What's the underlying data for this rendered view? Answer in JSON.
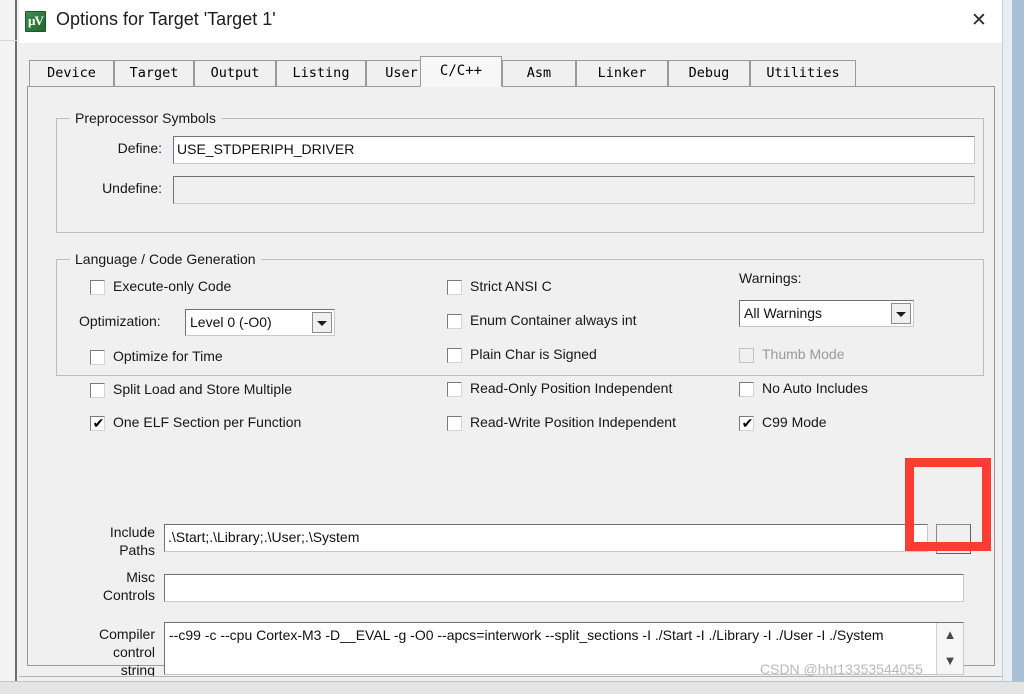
{
  "window": {
    "title": "Options for Target 'Target 1'",
    "app_icon": "keil-uvision-icon",
    "close_label": "✕"
  },
  "tabs": [
    {
      "label": "Device",
      "active": false
    },
    {
      "label": "Target",
      "active": false
    },
    {
      "label": "Output",
      "active": false
    },
    {
      "label": "Listing",
      "active": false
    },
    {
      "label": "User",
      "active": false
    },
    {
      "label": "C/C++",
      "active": true
    },
    {
      "label": "Asm",
      "active": false
    },
    {
      "label": "Linker",
      "active": false
    },
    {
      "label": "Debug",
      "active": false
    },
    {
      "label": "Utilities",
      "active": false
    }
  ],
  "preprocessor": {
    "legend": "Preprocessor Symbols",
    "define_label": "Define:",
    "define_value": "USE_STDPERIPH_DRIVER",
    "undefine_label": "Undefine:",
    "undefine_value": ""
  },
  "language": {
    "legend": "Language / Code Generation",
    "optimization_label": "Optimization:",
    "optimization_value": "Level 0 (-O0)",
    "warnings_label": "Warnings:",
    "warnings_value": "All Warnings",
    "column_left": [
      {
        "label": "Execute-only Code",
        "checked": false,
        "disabled": false
      },
      {
        "label": "Optimize for Time",
        "checked": false,
        "disabled": false
      },
      {
        "label": "Split Load and Store Multiple",
        "checked": false,
        "disabled": false
      },
      {
        "label": "One ELF Section per Function",
        "checked": true,
        "disabled": false
      }
    ],
    "column_middle": [
      {
        "label": "Strict ANSI C",
        "checked": false,
        "disabled": false
      },
      {
        "label": "Enum Container always int",
        "checked": false,
        "disabled": false
      },
      {
        "label": "Plain Char is Signed",
        "checked": false,
        "disabled": false
      },
      {
        "label": "Read-Only Position Independent",
        "checked": false,
        "disabled": false
      },
      {
        "label": "Read-Write Position Independent",
        "checked": false,
        "disabled": false
      }
    ],
    "column_right": [
      {
        "label": "Thumb Mode",
        "checked": false,
        "disabled": true
      },
      {
        "label": "No Auto Includes",
        "checked": false,
        "disabled": false
      },
      {
        "label": "C99 Mode",
        "checked": true,
        "disabled": false
      }
    ],
    "check_mark": "✔"
  },
  "paths": {
    "include_label_line1": "Include",
    "include_label_line2": "Paths",
    "include_value": ".\\Start;.\\Library;.\\User;.\\System",
    "include_browse_label": "...",
    "misc_label_line1": "Misc",
    "misc_label_line2": "Controls",
    "misc_value": ""
  },
  "compiler": {
    "label_line1": "Compiler",
    "label_line2": "control",
    "label_line3": "string",
    "value": "--c99 -c --cpu Cortex-M3 -D__EVAL -g -O0 --apcs=interwork --split_sections -I ./Start -I ./Library -I ./User -I ./System",
    "scroll_up": "▲",
    "scroll_down": "▼"
  },
  "annotation": {
    "highlight_color": "#fa3c32",
    "highlight_target": "include-paths-browse-button"
  },
  "watermark": {
    "text": "CSDN @hht13353544055"
  }
}
